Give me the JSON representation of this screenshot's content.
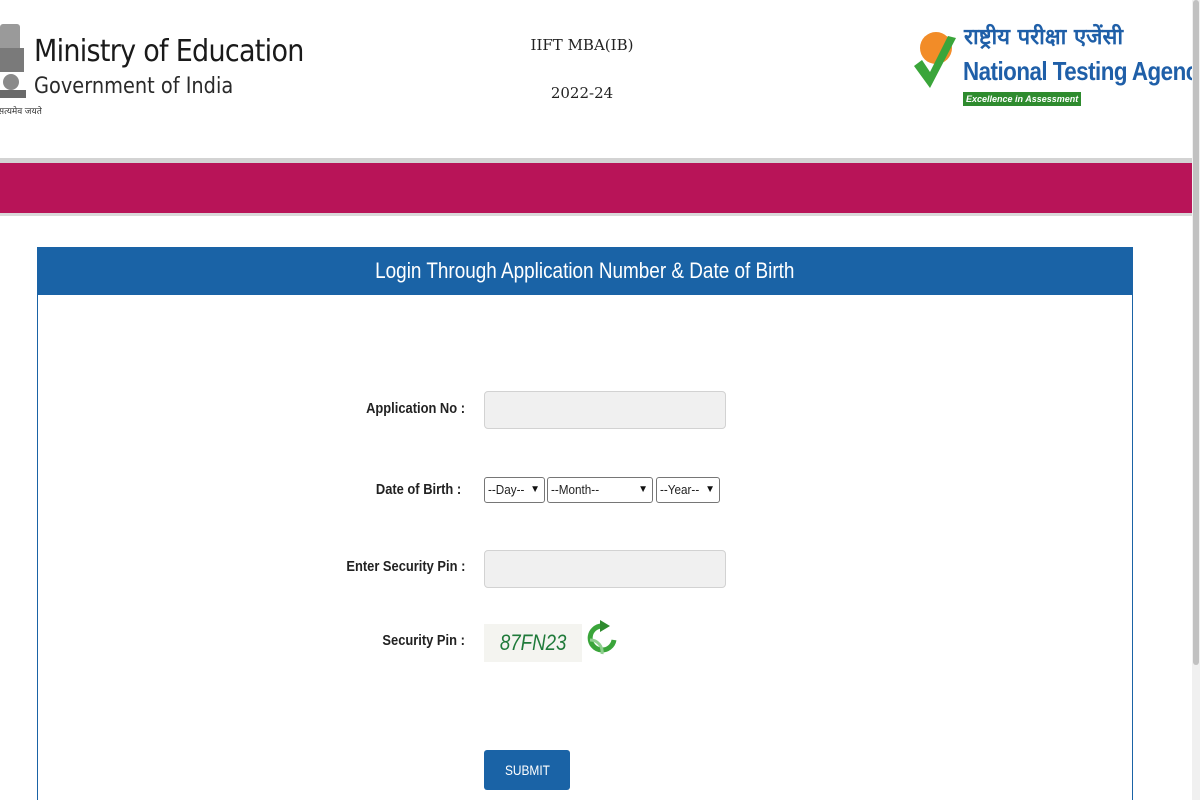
{
  "header": {
    "ministry_title": "Ministry of Education",
    "ministry_subtitle": "Government of India",
    "emblem_motto": "सत्यमेव जयते",
    "exam_name": "IIFT MBA(IB)",
    "exam_session": "2022-24",
    "agency_name_hindi": "राष्ट्रीय परीक्षा एजेंसी",
    "agency_name": "National Testing Agency",
    "agency_tagline": "Excellence in Assessment"
  },
  "colors": {
    "band": "#b81458",
    "primary": "#1a63a6",
    "agency_blue": "#1f5fa8",
    "tagline_green": "#2e8b2e",
    "logo_orange": "#f28c28",
    "logo_green": "#3aa53a"
  },
  "login": {
    "heading": "Login Through Application Number & Date of Birth",
    "application_no_label": "Application No :",
    "application_no_value": "",
    "dob_label": "Date of Birth :",
    "day_selected": "--Day--",
    "month_selected": "--Month--",
    "year_selected": "--Year--",
    "enter_pin_label": "Enter Security Pin :",
    "enter_pin_value": "",
    "security_pin_label": "Security Pin :",
    "captcha_text": "87FN23",
    "submit_label": "SUBMIT"
  },
  "icons": {
    "emblem": "national-emblem-icon",
    "agency_logo": "nta-checkmark-logo",
    "refresh": "refresh-icon",
    "dropdown": "chevron-down-icon"
  }
}
